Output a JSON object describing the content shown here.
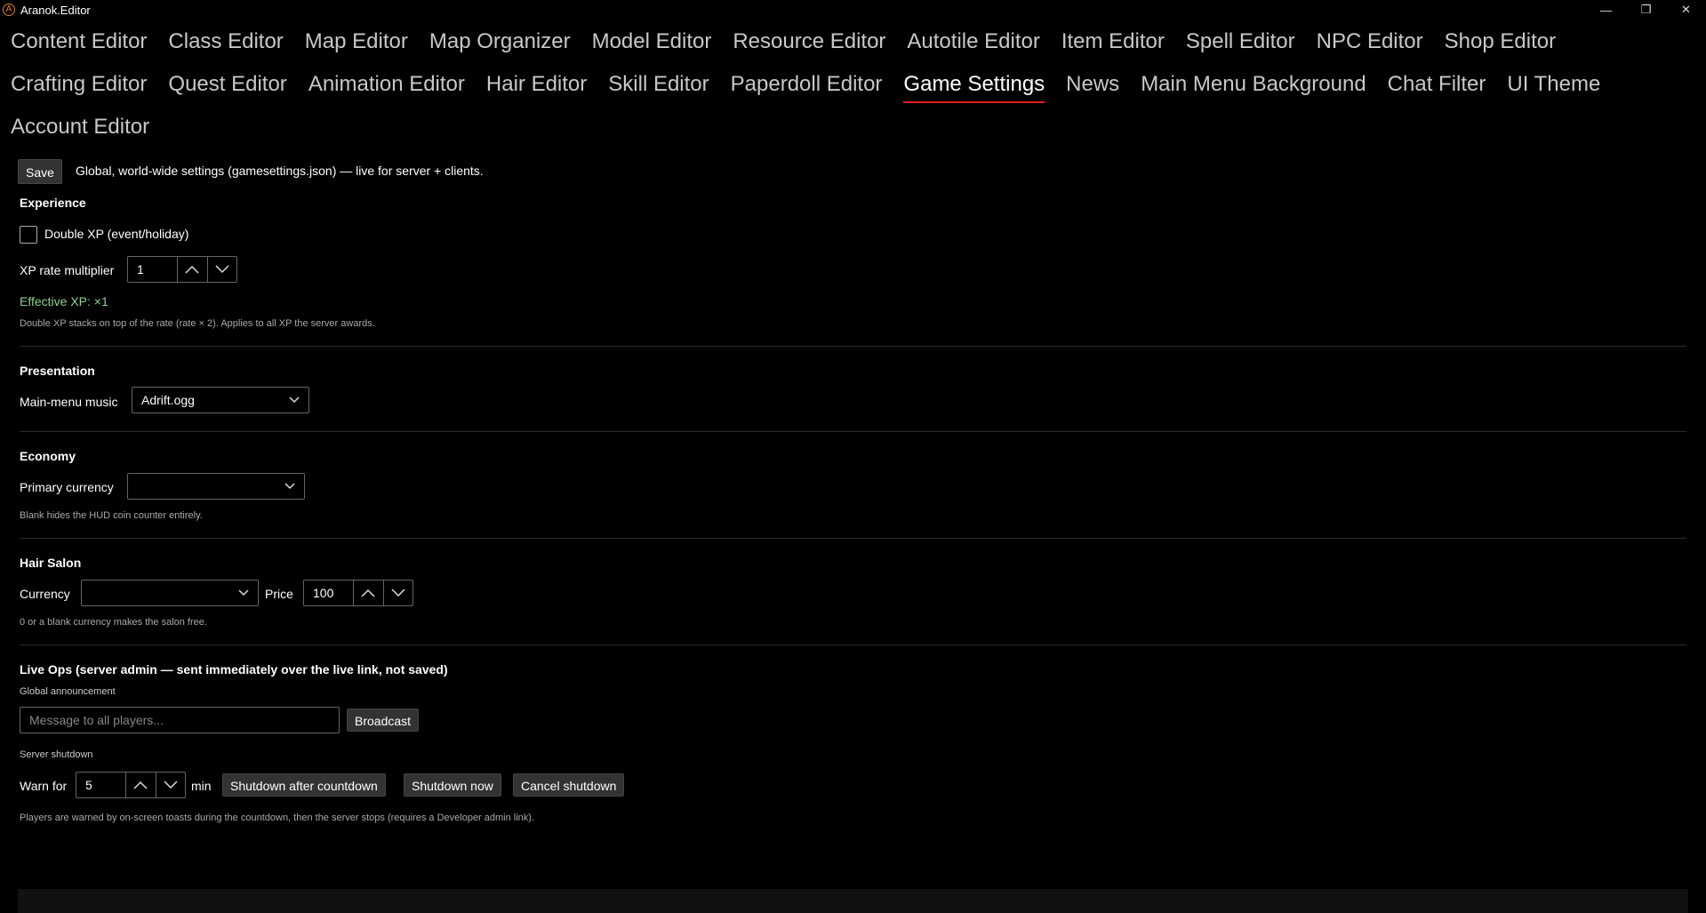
{
  "window": {
    "title": "Aranok.Editor",
    "app_icon": "A",
    "minimize": "—",
    "maximize": "❐",
    "close": "✕"
  },
  "tabs": [
    {
      "label": "Content Editor"
    },
    {
      "label": "Class Editor"
    },
    {
      "label": "Map Editor"
    },
    {
      "label": "Map Organizer"
    },
    {
      "label": "Model Editor"
    },
    {
      "label": "Resource Editor"
    },
    {
      "label": "Autotile Editor"
    },
    {
      "label": "Item Editor"
    },
    {
      "label": "Spell Editor"
    },
    {
      "label": "NPC Editor"
    },
    {
      "label": "Shop Editor"
    },
    {
      "label": "Crafting Editor"
    },
    {
      "label": "Quest Editor"
    },
    {
      "label": "Animation Editor"
    },
    {
      "label": "Hair Editor"
    },
    {
      "label": "Skill Editor"
    },
    {
      "label": "Paperdoll Editor"
    },
    {
      "label": "Game Settings",
      "active": true
    },
    {
      "label": "News"
    },
    {
      "label": "Main Menu Background"
    },
    {
      "label": "Chat Filter"
    },
    {
      "label": "UI Theme"
    },
    {
      "label": "Account Editor"
    }
  ],
  "toolbar": {
    "save_label": "Save",
    "description": "Global, world-wide settings (gamesettings.json) — live for server + clients."
  },
  "experience": {
    "heading": "Experience",
    "double_xp_label": "Double XP (event/holiday)",
    "double_xp_checked": false,
    "xp_rate_label": "XP rate multiplier",
    "xp_rate_value": "1",
    "effective_xp": "Effective XP: ×1",
    "note": "Double XP stacks on top of the rate (rate × 2). Applies to all XP the server awards."
  },
  "presentation": {
    "heading": "Presentation",
    "music_label": "Main-menu music",
    "music_value": "Adrift.ogg"
  },
  "economy": {
    "heading": "Economy",
    "currency_label": "Primary currency",
    "currency_value": "",
    "note": "Blank hides the HUD coin counter entirely."
  },
  "hair_salon": {
    "heading": "Hair Salon",
    "currency_label": "Currency",
    "currency_value": "",
    "price_label": "Price",
    "price_value": "100",
    "note": "0 or a blank currency makes the salon free."
  },
  "live_ops": {
    "heading": "Live Ops (server admin — sent immediately over the live link, not saved)",
    "announcement_label": "Global announcement",
    "announcement_placeholder": "Message to all players...",
    "broadcast_label": "Broadcast",
    "shutdown_label": "Server shutdown",
    "warn_label": "Warn for",
    "warn_value": "5",
    "min_label": "min",
    "shutdown_after_label": "Shutdown after countdown",
    "shutdown_now_label": "Shutdown now",
    "cancel_shutdown_label": "Cancel shutdown",
    "note": "Players are warned by on-screen toasts during the countdown, then the server stops (requires a Developer admin link)."
  },
  "colors": {
    "accent": "#e02020",
    "success": "#8fd18f",
    "background": "#000000"
  }
}
